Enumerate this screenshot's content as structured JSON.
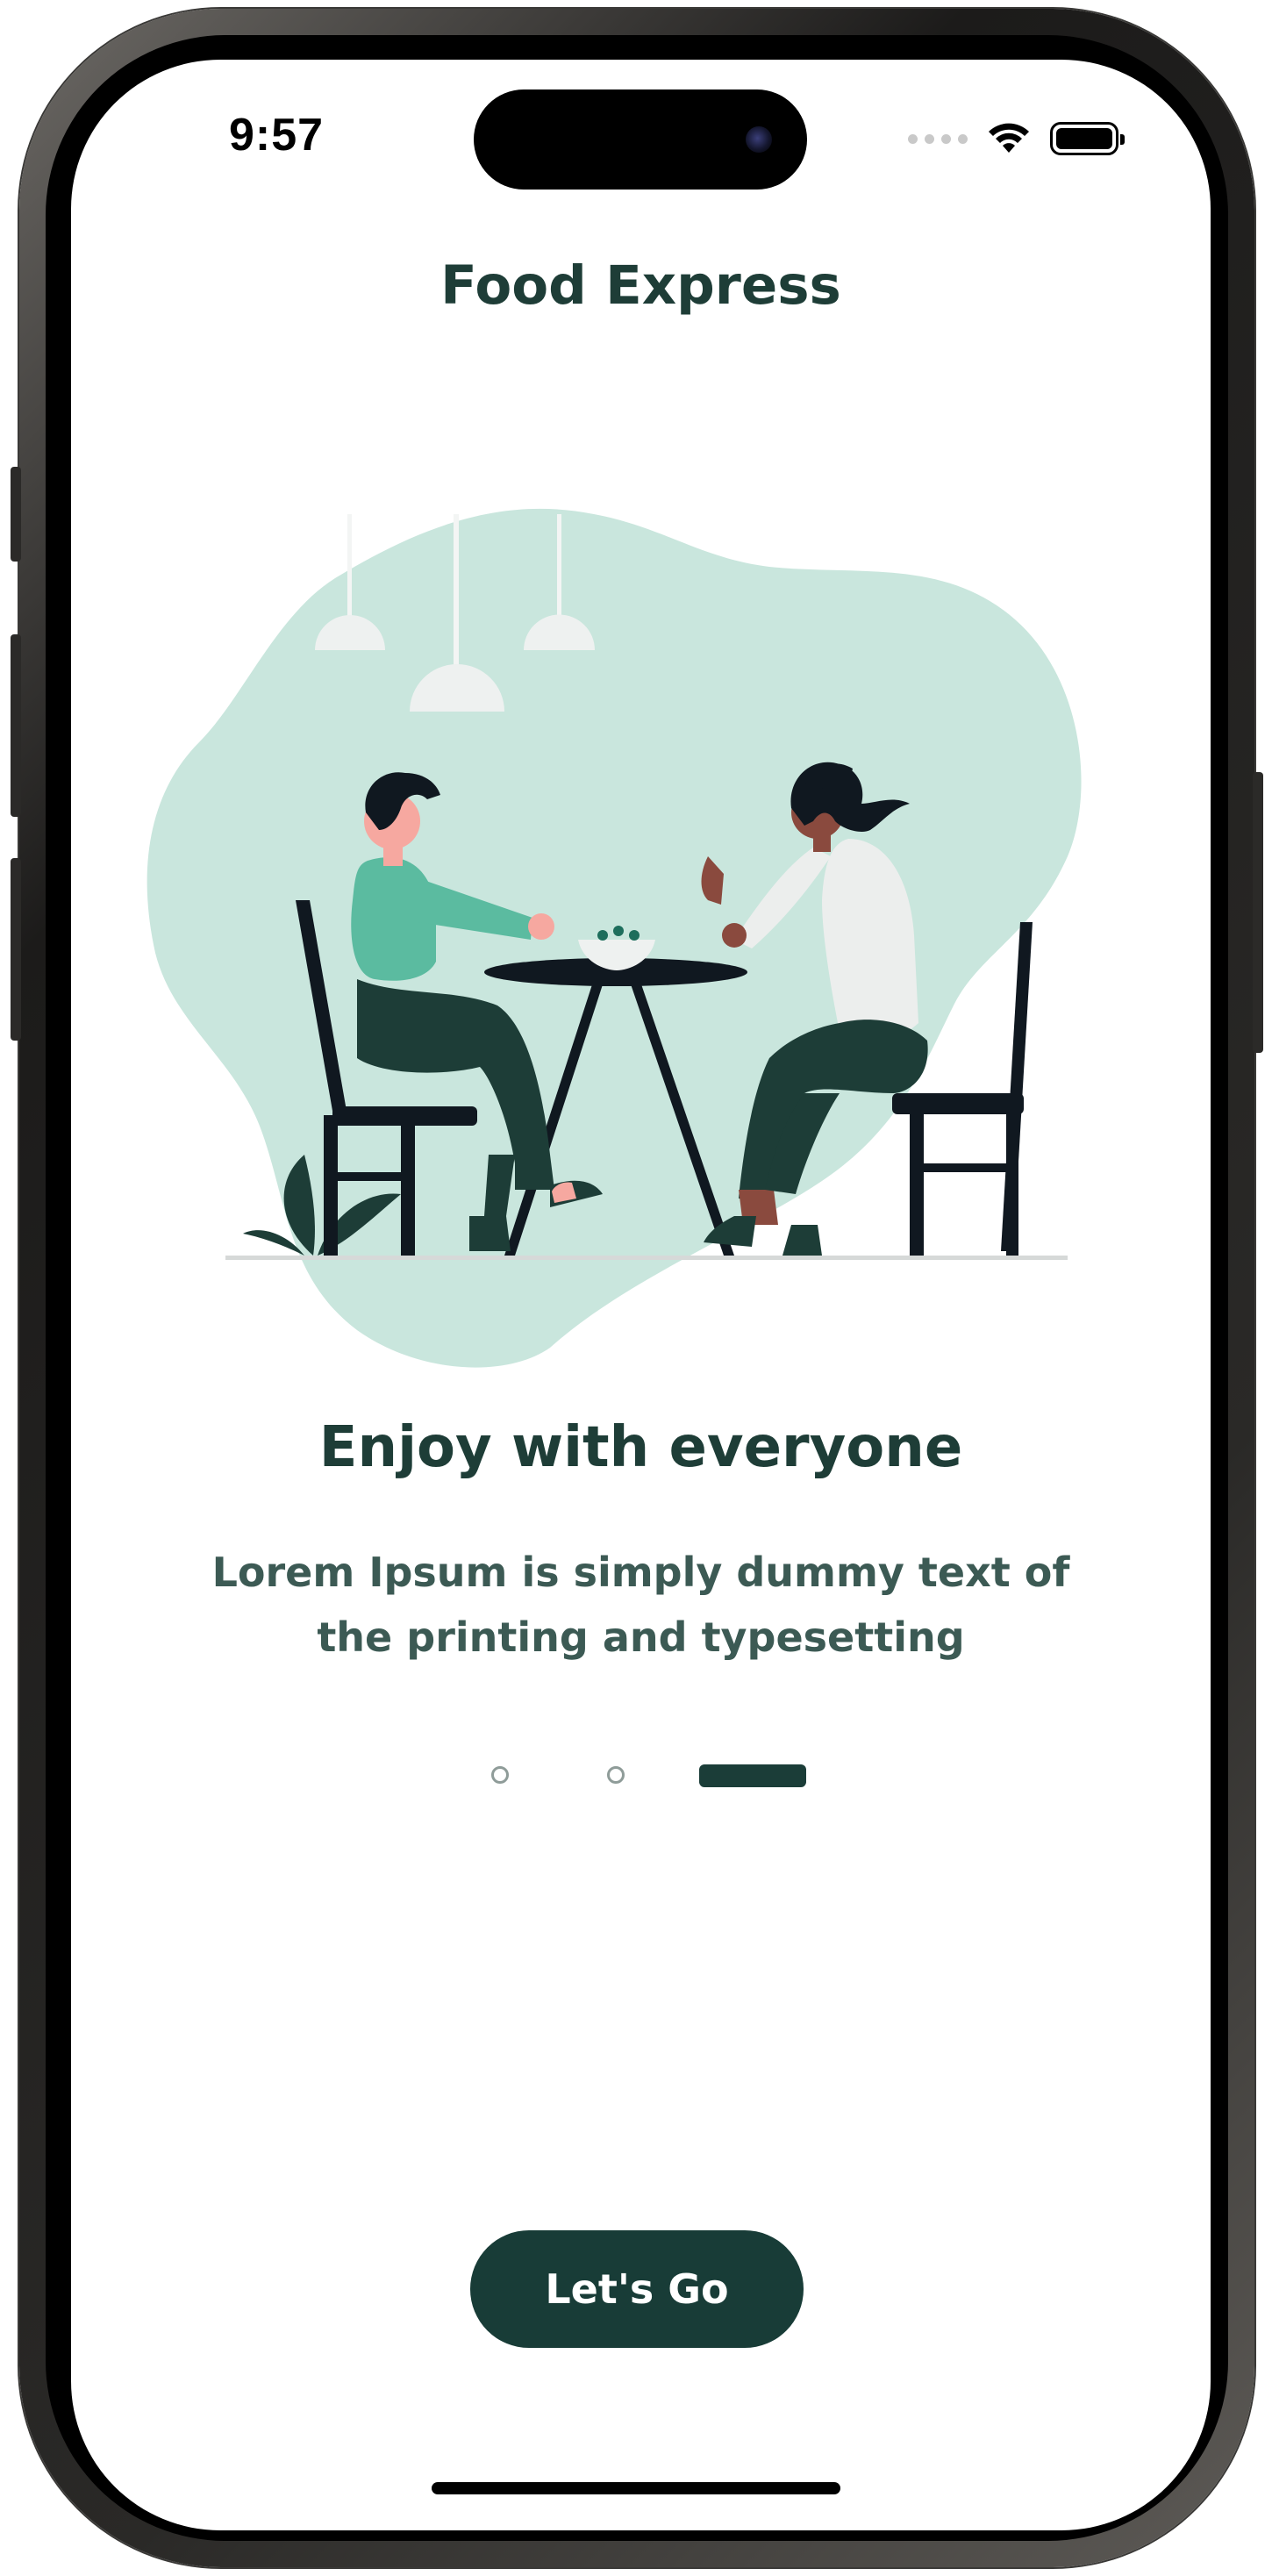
{
  "status_bar": {
    "time": "9:57",
    "icons": [
      "cellular-signal-icon",
      "wifi-icon",
      "battery-icon"
    ]
  },
  "header": {
    "title": "Food Express"
  },
  "illustration": {
    "icon": "couple-dining-illustration"
  },
  "onboarding": {
    "headline": "Enjoy with everyone",
    "description": "Lorem Ipsum is simply dummy text of the printing and typesetting",
    "page_count": 3,
    "active_page": 3
  },
  "actions": {
    "cta_label": "Let's Go"
  },
  "colors": {
    "primary": "#183c37",
    "title_text": "#1e3d37",
    "body_text": "#3c5a54",
    "blob": "#c9e6dd",
    "accent_green": "#5bbba0"
  }
}
